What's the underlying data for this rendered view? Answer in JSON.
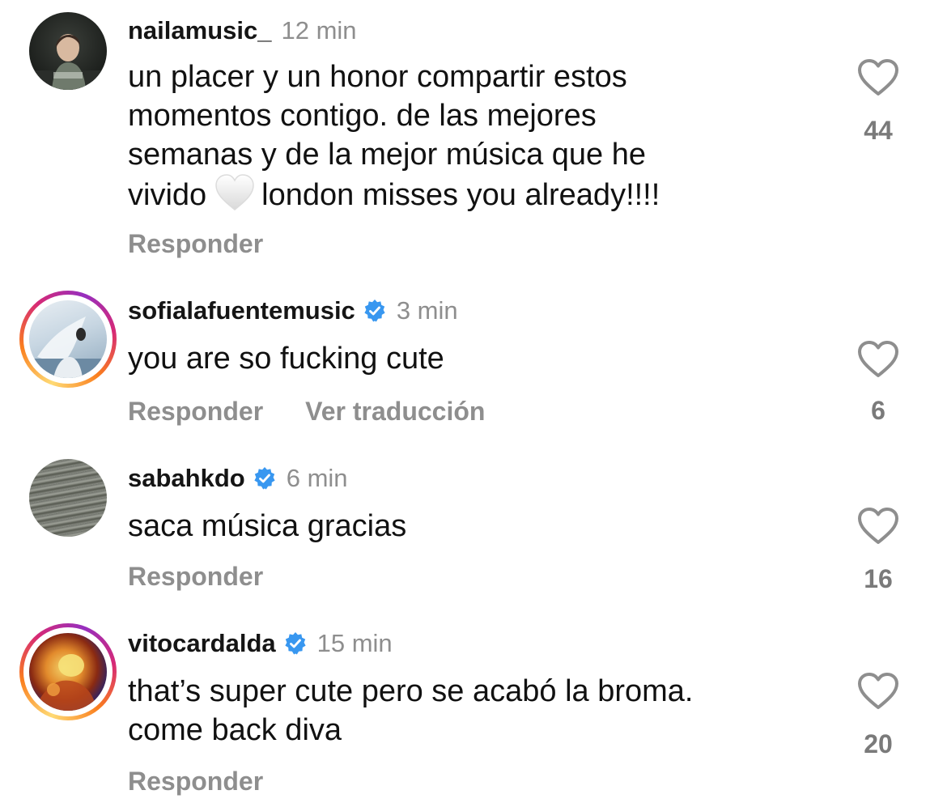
{
  "colors": {
    "text": "#111111",
    "muted": "#8e8e8e",
    "verified": "#3897f0",
    "story_ring": [
      "#feda75",
      "#fa7e1e",
      "#d62976",
      "#962fbf"
    ]
  },
  "comments": [
    {
      "username": "nailamusic_",
      "verified": false,
      "time": "12 min",
      "lines": [
        "un placer y un honor compartir estos",
        "momentos contigo. de las mejores",
        "semanas y de la mejor música que he"
      ],
      "last_line_before_emoji": "vivido",
      "emoji": "white-heart-emoji",
      "last_line_after_emoji": "london misses you already!!!!",
      "reply_label": "Responder",
      "likes": "44",
      "icon": "heart-outline-icon"
    },
    {
      "username": "sofialafuentemusic",
      "verified": true,
      "time": "3 min",
      "lines": [
        "you are so fucking cute"
      ],
      "reply_label": "Responder",
      "translate_label": "Ver traducción",
      "likes": "6",
      "icon": "heart-outline-icon"
    },
    {
      "username": "sabahkdo",
      "verified": true,
      "time": "6 min",
      "lines": [
        "saca música gracias"
      ],
      "reply_label": "Responder",
      "likes": "16",
      "icon": "heart-outline-icon"
    },
    {
      "username": "vitocardalda",
      "verified": true,
      "time": "15 min",
      "lines": [
        "that’s super cute pero se acabó la broma.",
        "come back diva"
      ],
      "reply_label": "Responder",
      "likes": "20",
      "icon": "heart-outline-icon"
    }
  ]
}
